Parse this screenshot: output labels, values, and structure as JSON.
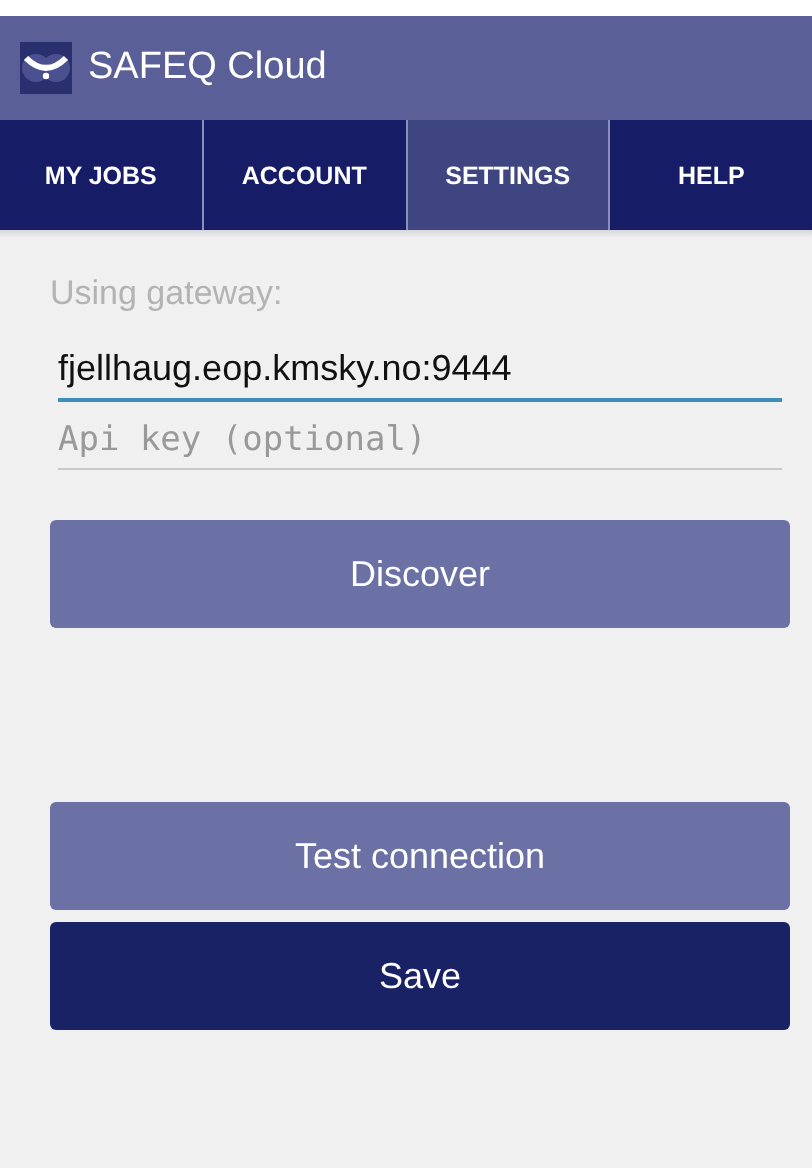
{
  "app_bar": {
    "title": "SAFEQ Cloud"
  },
  "tabs": [
    {
      "label": "MY JOBS",
      "selected": false
    },
    {
      "label": "ACCOUNT",
      "selected": false
    },
    {
      "label": "SETTINGS",
      "selected": true
    },
    {
      "label": "HELP",
      "selected": false
    }
  ],
  "settings": {
    "gateway_label": "Using gateway:",
    "gateway_field": {
      "value": "fjellhaug.eop.kmsky.no:9444",
      "focused": true
    },
    "api_key_field": {
      "placeholder": "Api key (optional)",
      "focused": false
    },
    "buttons": [
      {
        "label": "Discover",
        "kind": "secondary"
      },
      {
        "label": "Test connection",
        "kind": "secondary"
      },
      {
        "label": "Save",
        "kind": "primary"
      }
    ]
  }
}
